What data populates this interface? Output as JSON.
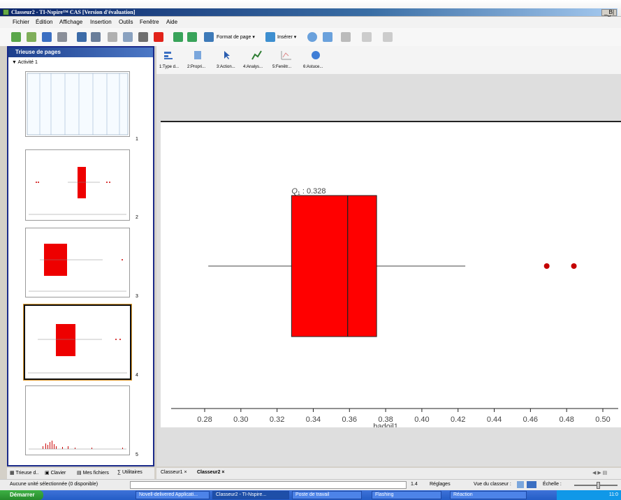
{
  "window": {
    "title": "Classeur2 - TI-Nspire™ CAS [Version d'évaluation]",
    "controls": "_ B| X"
  },
  "menubar": [
    "Fichier",
    "Édition",
    "Affichage",
    "Insertion",
    "Outils",
    "Fenêtre",
    "Aide"
  ],
  "toolbar": {
    "format_label": "Format de page ▾",
    "insert_label": "Insérer ▾"
  },
  "page_sorter": {
    "title": "Trieuse de pages",
    "activity": "Activité 1",
    "pages": [
      "1",
      "2",
      "3",
      "4",
      "5"
    ],
    "selected_page": "4"
  },
  "tool_menu": {
    "items": [
      {
        "label": "1:Type d...",
        "icon": "plot-type-icon"
      },
      {
        "label": "2:Propri...",
        "icon": "properties-icon"
      },
      {
        "label": "3:Action...",
        "icon": "actions-icon"
      },
      {
        "label": "4:Analys...",
        "icon": "analyze-icon"
      },
      {
        "label": "5:Fenêtr...",
        "icon": "window-icon"
      },
      {
        "label": "6:Astuce...",
        "icon": "hints-icon"
      }
    ]
  },
  "left_tabs": [
    "Trieuse d..",
    "Clavier",
    "Mes fichiers",
    "Utilitaires"
  ],
  "doc_tabs": [
    {
      "label": "Classeur1",
      "close": "×"
    },
    {
      "label": "Classeur2",
      "close": "×"
    }
  ],
  "doc_nav": "◀ ▶ ▤",
  "status": {
    "selection": "Aucune unité sélectionnée (0 disponible)",
    "ratio": "1.4",
    "settings": "Réglages",
    "view": "Vue du classeur :",
    "scale": "Échelle :"
  },
  "taskbar": {
    "start": "Démarrer",
    "tasks": [
      "Novell-delivered Applicati...",
      "Classeur2 - TI-Nspire...",
      "Poste de travail",
      "Flashing",
      "Réaction"
    ],
    "clock": "11:0"
  },
  "chart_data": {
    "type": "boxplot",
    "xlabel": "badoil1",
    "xlim": [
      0.27,
      0.5
    ],
    "ticks": [
      0.28,
      0.3,
      0.32,
      0.34,
      0.36,
      0.38,
      0.4,
      0.42,
      0.44,
      0.46,
      0.48,
      0.5
    ],
    "tick_labels": [
      "0.28",
      "0.30",
      "0.32",
      "0.34",
      "0.36",
      "0.38",
      "0.40",
      "0.42",
      "0.44",
      "0.46",
      "0.48",
      "0.50"
    ],
    "box": {
      "whisker_low": 0.282,
      "q1": 0.328,
      "median": 0.359,
      "q3": 0.375,
      "whisker_high": 0.424
    },
    "outliers": [
      0.469,
      0.484
    ],
    "annotation": {
      "label_sym": "Q",
      "label_sub": "1",
      "label_val": ": 0.328"
    },
    "box_color": "#ff0000",
    "outlier_color": "#c40000"
  }
}
